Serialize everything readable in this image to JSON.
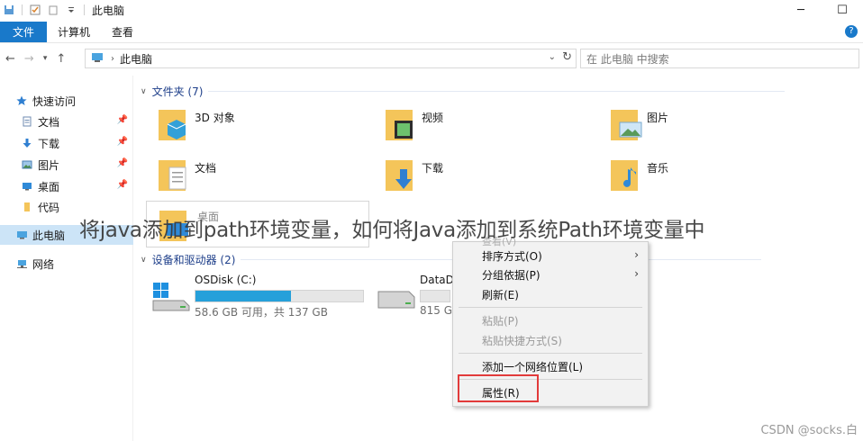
{
  "window": {
    "title": "此电脑",
    "quick_access_icons": [
      "save-icon",
      "checklist-icon",
      "folder-icon",
      "customize-dropdown-icon"
    ],
    "minimize_glyph": "─",
    "maximize_glyph": "☐"
  },
  "ribbon": {
    "tabs": [
      "文件",
      "计算机",
      "查看"
    ],
    "help_glyph": "?"
  },
  "address_bar": {
    "path": "此电脑",
    "search_placeholder": "在 此电脑 中搜索"
  },
  "nav_pane": {
    "quick_access": "快速访问",
    "items": [
      {
        "label": "文档",
        "icon": "documents-icon",
        "pinned": true
      },
      {
        "label": "下载",
        "icon": "download-icon",
        "pinned": true
      },
      {
        "label": "图片",
        "icon": "pictures-icon",
        "pinned": true
      },
      {
        "label": "桌面",
        "icon": "desktop-icon",
        "pinned": true
      },
      {
        "label": "代码",
        "icon": "folder-icon",
        "pinned": false
      }
    ],
    "this_pc": "此电脑",
    "network": "网络"
  },
  "content": {
    "folders_header": "文件夹 (7)",
    "folders": [
      {
        "label": "3D 对象",
        "icon": "3d-objects-icon"
      },
      {
        "label": "视频",
        "icon": "videos-icon"
      },
      {
        "label": "图片",
        "icon": "pictures-icon"
      },
      {
        "label": "文档",
        "icon": "documents-icon"
      },
      {
        "label": "下载",
        "icon": "download-icon"
      },
      {
        "label": "音乐",
        "icon": "music-icon"
      },
      {
        "label": "桌面",
        "icon": "desktop-icon"
      }
    ],
    "drives_header": "设备和驱动器 (2)",
    "drives": [
      {
        "name": "OSDisk (C:)",
        "detail": "58.6 GB 可用，共 137 GB",
        "used_fraction": 0.57
      },
      {
        "name": "DataD",
        "detail": "815 G",
        "used_fraction": 0.0
      }
    ]
  },
  "context_menu": {
    "partial_top": "查看(V)",
    "items": [
      {
        "label": "排序方式(O)",
        "submenu": true,
        "enabled": true
      },
      {
        "label": "分组依据(P)",
        "submenu": true,
        "enabled": true
      },
      {
        "label": "刷新(E)",
        "submenu": false,
        "enabled": true
      },
      {
        "label": "粘贴(P)",
        "submenu": false,
        "enabled": false
      },
      {
        "label": "粘贴快捷方式(S)",
        "submenu": false,
        "enabled": false
      },
      {
        "label": "添加一个网络位置(L)",
        "submenu": false,
        "enabled": true
      },
      {
        "label": "属性(R)",
        "submenu": false,
        "enabled": true,
        "highlighted": true
      }
    ]
  },
  "overlay_caption": "将java添加到path环境变量，如何将Java添加到系统Path环境变量中",
  "watermark": "CSDN @socks.白",
  "colors": {
    "accent": "#1979ca",
    "selection": "#cce4f7",
    "drive_bar": "#26a0da",
    "highlight_box": "#e23b3b",
    "folder": "#f4c55a"
  }
}
